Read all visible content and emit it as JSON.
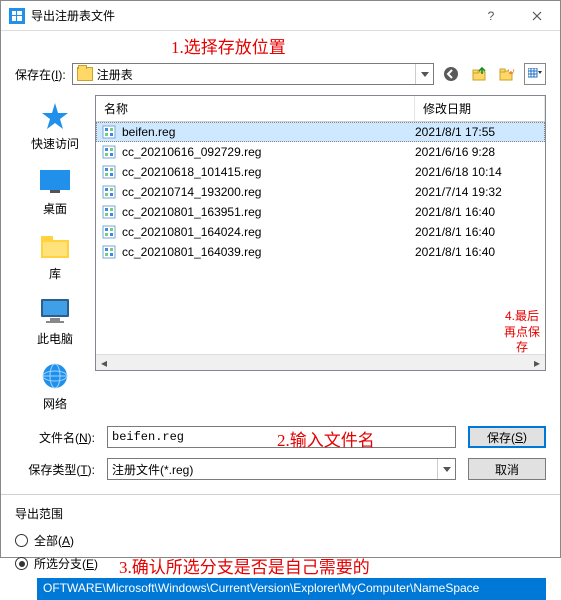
{
  "window": {
    "title": "导出注册表文件"
  },
  "annotations": {
    "a1": "1.选择存放位置",
    "a2": "2.输入文件名",
    "a3": "3.确认所选分支是否是自己需要的",
    "a4l1": "4.最后",
    "a4l2": "再点保",
    "a4l3": "存"
  },
  "labels": {
    "savein_pre": "保存在(",
    "savein_key": "I",
    "savein_post": "):",
    "filename_pre": "文件名(",
    "filename_key": "N",
    "filename_post": "):",
    "savetype_pre": "保存类型(",
    "savetype_key": "T",
    "savetype_post": "):",
    "save_pre": "保存(",
    "save_key": "S",
    "save_post": ")",
    "cancel": "取消",
    "range": "导出范围",
    "all_pre": "全部(",
    "all_key": "A",
    "all_post": ")",
    "branch_pre": "所选分支(",
    "branch_key": "E",
    "branch_post": ")"
  },
  "location": "注册表",
  "places": {
    "quick": "快速访问",
    "desktop": "桌面",
    "lib": "库",
    "pc": "此电脑",
    "net": "网络"
  },
  "headers": {
    "name": "名称",
    "date": "修改日期"
  },
  "files": [
    {
      "name": "beifen.reg",
      "date": "2021/8/1 17:55",
      "selected": true
    },
    {
      "name": "cc_20210616_092729.reg",
      "date": "2021/6/16 9:28",
      "selected": false
    },
    {
      "name": "cc_20210618_101415.reg",
      "date": "2021/6/18 10:14",
      "selected": false
    },
    {
      "name": "cc_20210714_193200.reg",
      "date": "2021/7/14 19:32",
      "selected": false
    },
    {
      "name": "cc_20210801_163951.reg",
      "date": "2021/8/1 16:40",
      "selected": false
    },
    {
      "name": "cc_20210801_164024.reg",
      "date": "2021/8/1 16:40",
      "selected": false
    },
    {
      "name": "cc_20210801_164039.reg",
      "date": "2021/8/1 16:40",
      "selected": false
    }
  ],
  "filename_value": "beifen.reg",
  "savetype_value": "注册文件(*.reg)",
  "branch_path": "OFTWARE\\Microsoft\\Windows\\CurrentVersion\\Explorer\\MyComputer\\NameSpace"
}
